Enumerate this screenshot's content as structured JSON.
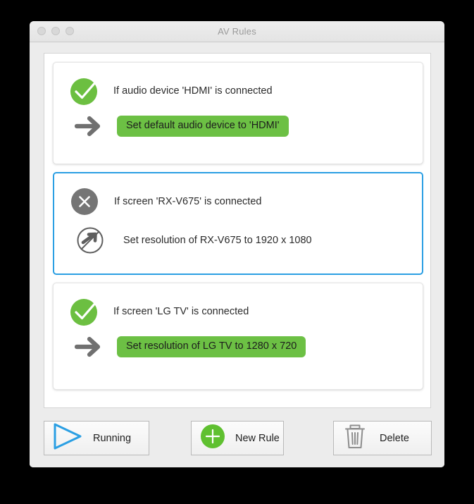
{
  "window": {
    "title": "AV Rules",
    "traffic_lights": [
      "close-button",
      "minimize-button",
      "zoom-button"
    ]
  },
  "colors": {
    "accent_green": "#6cc044",
    "selection_blue": "#2b9fe3",
    "icon_gray": "#707070",
    "window_background": "#ececec"
  },
  "rules": [
    {
      "status_icon": "check-circle-icon",
      "enabled": true,
      "selected": false,
      "condition": "If audio device 'HDMI' is connected",
      "action_icon": "arrow-right-icon",
      "action": "Set default audio device to 'HDMI'",
      "action_style": "pill"
    },
    {
      "status_icon": "x-circle-icon",
      "enabled": false,
      "selected": true,
      "condition": "If screen 'RX-V675' is connected",
      "action_icon": "arrow-disabled-icon",
      "action": "Set resolution of RX-V675 to 1920 x 1080",
      "action_style": "plain"
    },
    {
      "status_icon": "check-circle-icon",
      "enabled": true,
      "selected": false,
      "condition": "If screen 'LG TV' is connected",
      "action_icon": "arrow-right-icon",
      "action": "Set resolution of LG TV to 1280 x 720",
      "action_style": "pill"
    }
  ],
  "toolbar": {
    "running": {
      "label": "Running",
      "icon": "play-triangle-icon"
    },
    "new_rule": {
      "label": "New Rule",
      "icon": "plus-circle-icon"
    },
    "delete": {
      "label": "Delete",
      "icon": "trash-icon"
    }
  }
}
